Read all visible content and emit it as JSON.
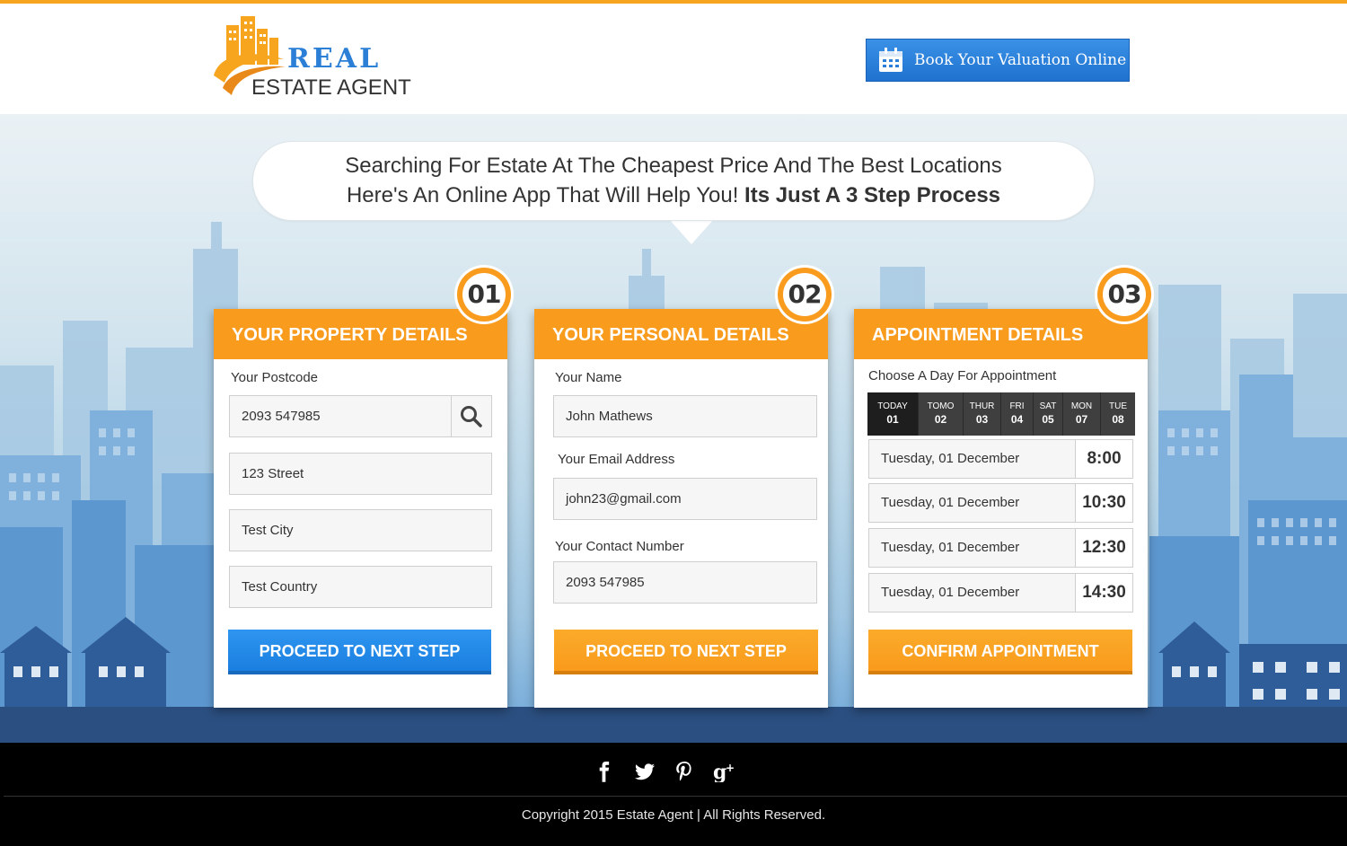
{
  "header": {
    "logo_word1": "REAL",
    "logo_word2": "ESTATE AGENT",
    "book_button": "Book Your Valuation Online",
    "book_icon": "calendar-icon"
  },
  "hero": {
    "line1": "Searching For Estate At The Cheapest Price And The Best Locations",
    "line2_prefix": "Here's An Online App That Will Help You! ",
    "line2_bold": "Its Just A 3 Step Process"
  },
  "step1": {
    "number": "01",
    "title": "YOUR PROPERTY DETAILS",
    "postcode_label": "Your Postcode",
    "postcode_value": "2093 547985",
    "street_value": "123 Street",
    "city_value": "Test City",
    "country_value": "Test Country",
    "button": "PROCEED TO NEXT STEP"
  },
  "step2": {
    "number": "02",
    "title": "YOUR PERSONAL DETAILS",
    "name_label": "Your Name",
    "name_value": "John Mathews",
    "email_label": "Your Email Address",
    "email_value": "john23@gmail.com",
    "phone_label": "Your Contact Number",
    "phone_value": "2093 547985",
    "button": "PROCEED TO NEXT STEP"
  },
  "step3": {
    "number": "03",
    "title": "APPOINTMENT DETAILS",
    "choose_label": "Choose A Day For Appointment",
    "days": [
      {
        "name": "TODAY",
        "num": "01"
      },
      {
        "name": "TOMO",
        "num": "02"
      },
      {
        "name": "THUR",
        "num": "03"
      },
      {
        "name": "FRI",
        "num": "04"
      },
      {
        "name": "SAT",
        "num": "05"
      },
      {
        "name": "MON",
        "num": "07"
      },
      {
        "name": "TUE",
        "num": "08"
      }
    ],
    "slots": [
      {
        "date": "Tuesday, 01 December",
        "time": "8:00"
      },
      {
        "date": "Tuesday, 01 December",
        "time": "10:30"
      },
      {
        "date": "Tuesday, 01 December",
        "time": "12:30"
      },
      {
        "date": "Tuesday, 01 December",
        "time": "14:30"
      }
    ],
    "button": "CONFIRM APPOINTMENT"
  },
  "footer": {
    "social_icons": [
      "facebook-icon",
      "twitter-icon",
      "pinterest-icon",
      "google-plus-icon"
    ],
    "copyright": "Copyright 2015 Estate Agent  |  All Rights Reserved."
  },
  "colors": {
    "accent_orange": "#f99b1c",
    "accent_blue": "#1f7fe0",
    "footer_bg": "#000000"
  }
}
